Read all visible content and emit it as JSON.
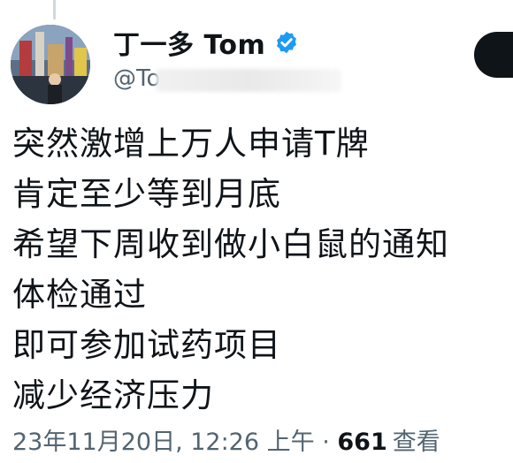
{
  "author": {
    "display_name": "丁一多 Tom",
    "handle_visible": "@To",
    "verified": true
  },
  "icons": {
    "verified": "verified-badge-icon",
    "avatar": "profile-avatar-photo"
  },
  "colors": {
    "verified_blue": "#1d9bf0",
    "text_primary": "#0f1419",
    "text_secondary": "#536471",
    "follow_button": "#0f1419"
  },
  "tweet": {
    "lines": [
      "突然激增上万人申请T牌",
      "肯定至少等到月底",
      "希望下周收到做小白鼠的通知",
      "体检通过",
      "即可参加试药项目",
      "减少经济压力"
    ]
  },
  "meta": {
    "timestamp": "23年11月20日, 12:26 上午",
    "separator": " · ",
    "views_count": "661",
    "views_label": "查看"
  }
}
